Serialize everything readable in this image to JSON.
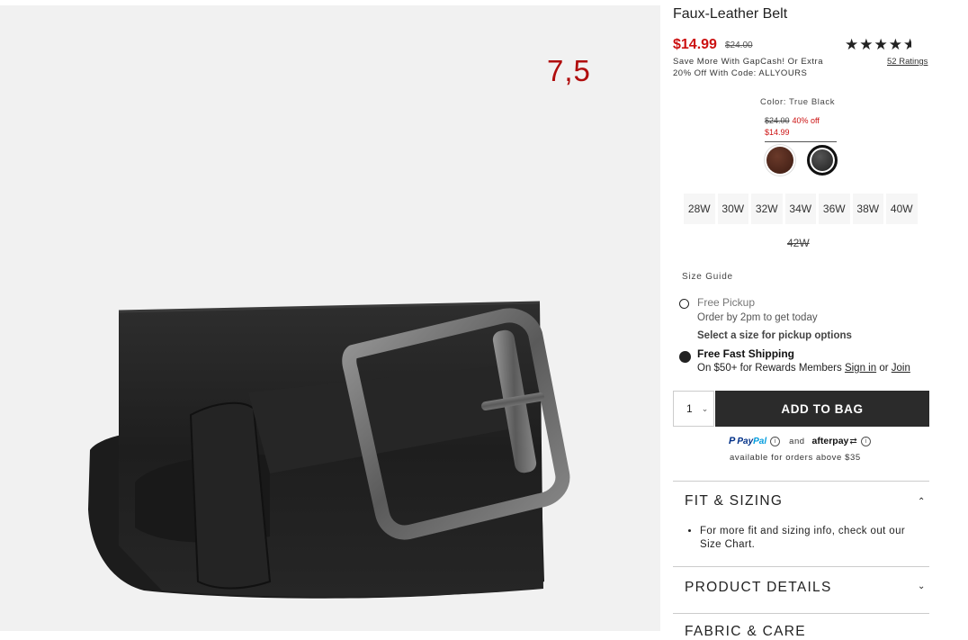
{
  "image_overlay": {
    "rating_text": "7,5"
  },
  "product": {
    "title": "Faux-Leather Belt",
    "sale_price": "$14.99",
    "original_price": "$24.00",
    "promo_line1": "Save More With GapCash! Or Extra",
    "promo_line2": "20% Off With Code: ALLYOURS",
    "rating_value": 4.5,
    "ratings_link": "52 Ratings"
  },
  "color": {
    "label": "Color: True Black",
    "price_original": "$24.00",
    "discount": "40% off",
    "price_sale": "$14.99",
    "swatches": [
      {
        "name": "brown",
        "color": "#4a2418",
        "selected": false
      },
      {
        "name": "true-black",
        "color": "#222222",
        "selected": true
      }
    ]
  },
  "sizes": {
    "available": [
      "28W",
      "30W",
      "32W",
      "34W",
      "36W",
      "38W",
      "40W"
    ],
    "unavailable": [
      "42W"
    ],
    "guide_label": "Size Guide"
  },
  "fulfillment": {
    "pickup_title": "Free Pickup",
    "pickup_subtitle": "Order by 2pm to get today",
    "pickup_select": "Select a size for pickup options",
    "shipping_title": "Free Fast Shipping",
    "shipping_subtitle": "On $50+ for Rewards Members",
    "sign_in": "Sign in",
    "or": "or",
    "join": "Join"
  },
  "cart": {
    "quantity": "1",
    "add_to_bag": "ADD TO BAG"
  },
  "payment": {
    "paypal_p": "P",
    "paypal_name_a": "Pay",
    "paypal_name_b": "Pal",
    "and": "and",
    "afterpay": "afterpay",
    "note": "available for orders above $35",
    "info_glyph": "i"
  },
  "accordion": {
    "fit_title": "FIT & SIZING",
    "fit_text": "For more fit and sizing info, check out our Size Chart.",
    "details_title": "PRODUCT DETAILS",
    "fabric_title": "FABRIC & CARE"
  },
  "colors": {
    "sale_red": "#cc1111",
    "overlay_red": "#b00d0d",
    "button_dark": "#2b2b2b"
  }
}
